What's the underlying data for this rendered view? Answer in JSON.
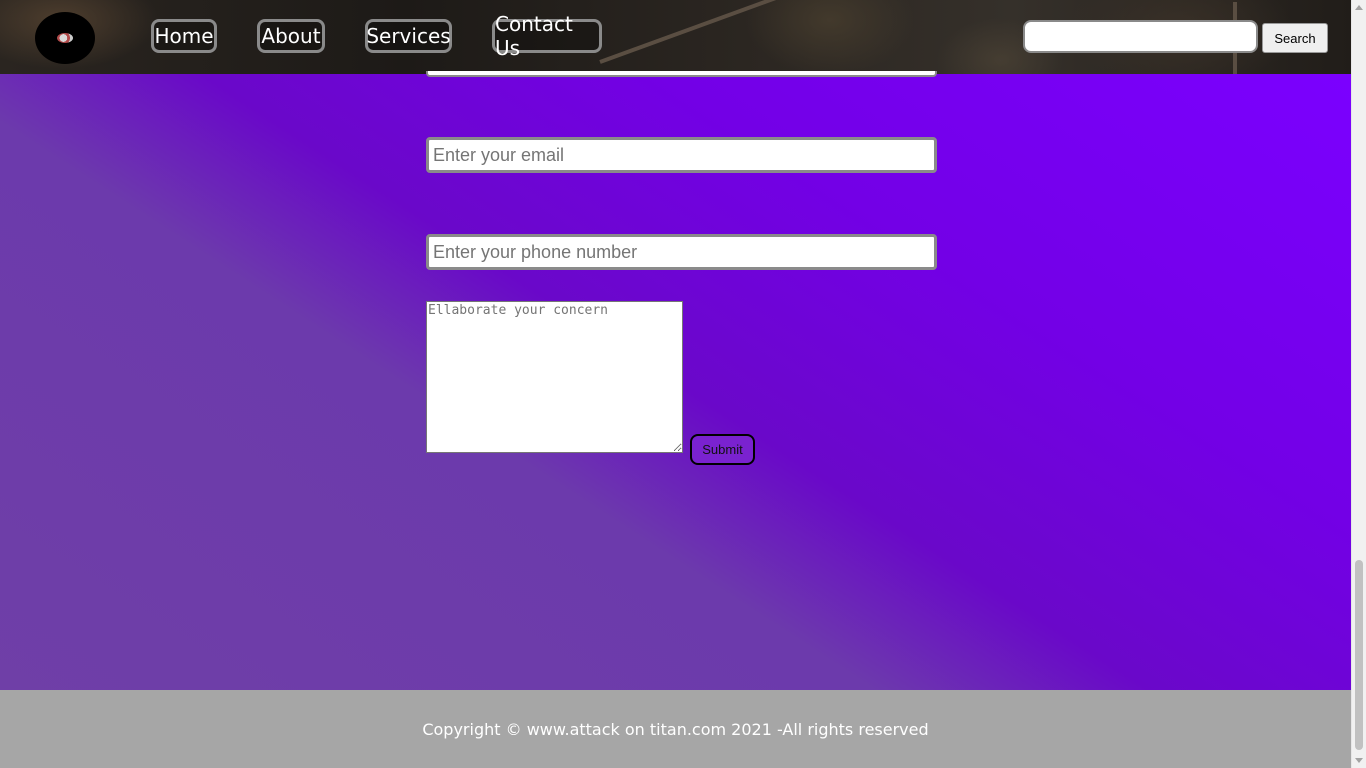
{
  "header": {
    "logo_icon": "titan-emblem-icon",
    "nav": [
      {
        "label": "Home"
      },
      {
        "label": "About"
      },
      {
        "label": "Services"
      },
      {
        "label": "Contact Us"
      }
    ],
    "search": {
      "placeholder": "",
      "value": "",
      "button_label": "Search"
    }
  },
  "form": {
    "email_placeholder": "Enter your email",
    "phone_placeholder": "Enter your phone number",
    "concern_placeholder": "Ellaborate your concern",
    "submit_label": "Submit"
  },
  "footer": {
    "copyright": "Copyright © www.attack on titan.com 2021 -All rights reserved"
  },
  "colors": {
    "accent_purple": "#7b00ff",
    "muted_purple": "#6f3fa7",
    "footer_gray": "#a6a6a6"
  }
}
